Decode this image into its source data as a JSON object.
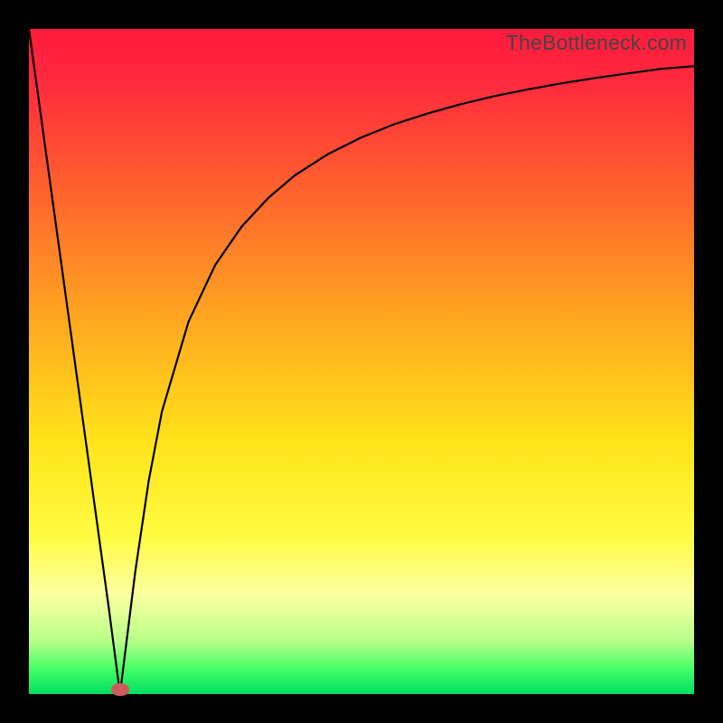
{
  "watermark": "TheBottleneck.com",
  "colors": {
    "frame": "#000000",
    "curve": "#000000",
    "marker": "#cc5a5a"
  },
  "chart_data": {
    "type": "line",
    "title": "",
    "xlabel": "",
    "ylabel": "",
    "xlim": [
      0,
      100
    ],
    "ylim": [
      0,
      100
    ],
    "grid": false,
    "legend": false,
    "x": [
      0,
      2,
      4,
      6,
      8,
      10,
      12,
      13.7,
      14,
      15,
      16,
      18,
      20,
      24,
      28,
      32,
      36,
      40,
      45,
      50,
      55,
      60,
      65,
      70,
      75,
      80,
      85,
      90,
      95,
      100
    ],
    "values": [
      100,
      85.5,
      71,
      56.5,
      42,
      27.5,
      13,
      0,
      2.5,
      10.5,
      18.5,
      32,
      42.5,
      56,
      64.5,
      70.3,
      74.6,
      78,
      81.2,
      83.7,
      85.7,
      87.3,
      88.7,
      89.9,
      90.9,
      91.8,
      92.6,
      93.3,
      94,
      94.4
    ],
    "marker": {
      "x": 13.7,
      "y": 0
    },
    "gradient_stops": [
      {
        "pos": 0,
        "color": "#ff1a3d"
      },
      {
        "pos": 22,
        "color": "#ff5a30"
      },
      {
        "pos": 44,
        "color": "#ffa820"
      },
      {
        "pos": 62,
        "color": "#ffe31a"
      },
      {
        "pos": 85,
        "color": "#fcffa0"
      },
      {
        "pos": 96,
        "color": "#4aff6a"
      },
      {
        "pos": 100,
        "color": "#00e060"
      }
    ]
  }
}
